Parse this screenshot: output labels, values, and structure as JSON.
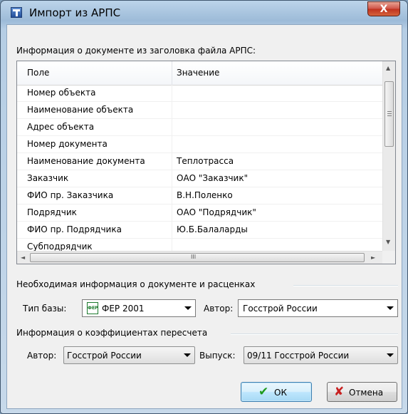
{
  "window": {
    "title": "Импорт из АРПС",
    "close_glyph": "X"
  },
  "doc_info": {
    "section_label": "Информация о документе из заголовка файла АРПС:",
    "columns": [
      "Поле",
      "Значение"
    ],
    "rows": [
      {
        "field": "Номер объекта",
        "value": ""
      },
      {
        "field": "Наименование объекта",
        "value": ""
      },
      {
        "field": "Адрес объекта",
        "value": ""
      },
      {
        "field": "Номер документа",
        "value": ""
      },
      {
        "field": "Наименование документа",
        "value": "Теплотрасса"
      },
      {
        "field": "Заказчик",
        "value": "ОАО \"Заказчик\""
      },
      {
        "field": "ФИО пр. Заказчика",
        "value": "В.Н.Поленко"
      },
      {
        "field": "Подрядчик",
        "value": "ОАО \"Подрядчик\""
      },
      {
        "field": "ФИО пр. Подрядчика",
        "value": "Ю.Б.Балаларды"
      },
      {
        "field": "Субподрядчик",
        "value": ""
      }
    ],
    "hscroll_grip": "III"
  },
  "required_info": {
    "group_label": "Необходимая информация о документе и расценках",
    "base_type_label": "Тип базы:",
    "base_type_icon": "ФЕР",
    "base_type_value": "ФЕР 2001",
    "author_label": "Автор:",
    "author_value": "Госстрой России"
  },
  "coeff_info": {
    "group_label": "Информация о коэффициентах пересчета",
    "author_label": "Автор:",
    "author_value": "Госстрой России",
    "release_label": "Выпуск:",
    "release_value": "09/11 Госстрой России"
  },
  "buttons": {
    "ok_label": "ОК",
    "ok_icon": "✔",
    "cancel_label": "Отмена",
    "cancel_icon": "✘"
  },
  "colors": {
    "ok_icon": "#1e9a1e",
    "cancel_icon": "#c82020",
    "titlebar": "#a9c4e0"
  }
}
